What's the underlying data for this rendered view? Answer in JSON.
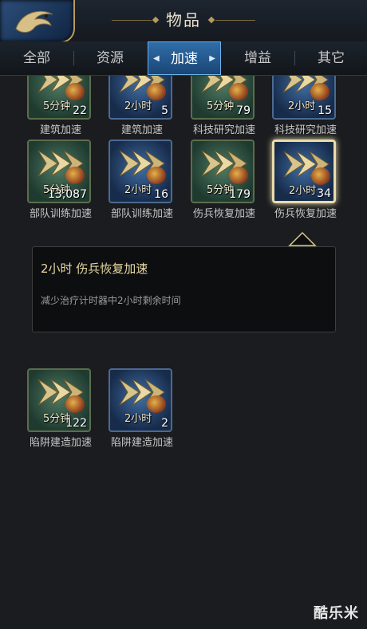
{
  "header": {
    "title": "物品"
  },
  "tabs": [
    {
      "label": "全部",
      "active": false
    },
    {
      "label": "资源",
      "active": false
    },
    {
      "label": "加速",
      "active": true
    },
    {
      "label": "增益",
      "active": false
    },
    {
      "label": "其它",
      "active": false
    }
  ],
  "items": [
    {
      "name": "建筑加速",
      "duration": "5分钟",
      "count": "22",
      "color": "green"
    },
    {
      "name": "建筑加速",
      "duration": "2小时",
      "count": "5",
      "color": "blue"
    },
    {
      "name": "科技研究加速",
      "duration": "5分钟",
      "count": "79",
      "color": "green"
    },
    {
      "name": "科技研究加速",
      "duration": "2小时",
      "count": "15",
      "color": "blue"
    },
    {
      "name": "部队训练加速",
      "duration": "5分钟",
      "count": "13,087",
      "color": "green"
    },
    {
      "name": "部队训练加速",
      "duration": "2小时",
      "count": "16",
      "color": "blue"
    },
    {
      "name": "伤兵恢复加速",
      "duration": "5分钟",
      "count": "179",
      "color": "green"
    },
    {
      "name": "伤兵恢复加速",
      "duration": "2小时",
      "count": "34",
      "color": "blue",
      "selected": true
    },
    {
      "name": "陷阱建造加速",
      "duration": "5分钟",
      "count": "122",
      "color": "green"
    },
    {
      "name": "陷阱建造加速",
      "duration": "2小时",
      "count": "2",
      "color": "blue"
    }
  ],
  "tooltip": {
    "title": "2小时 伤兵恢复加速",
    "description": "减少治疗计时器中2小时剩余时间"
  },
  "watermark": "酷乐米"
}
